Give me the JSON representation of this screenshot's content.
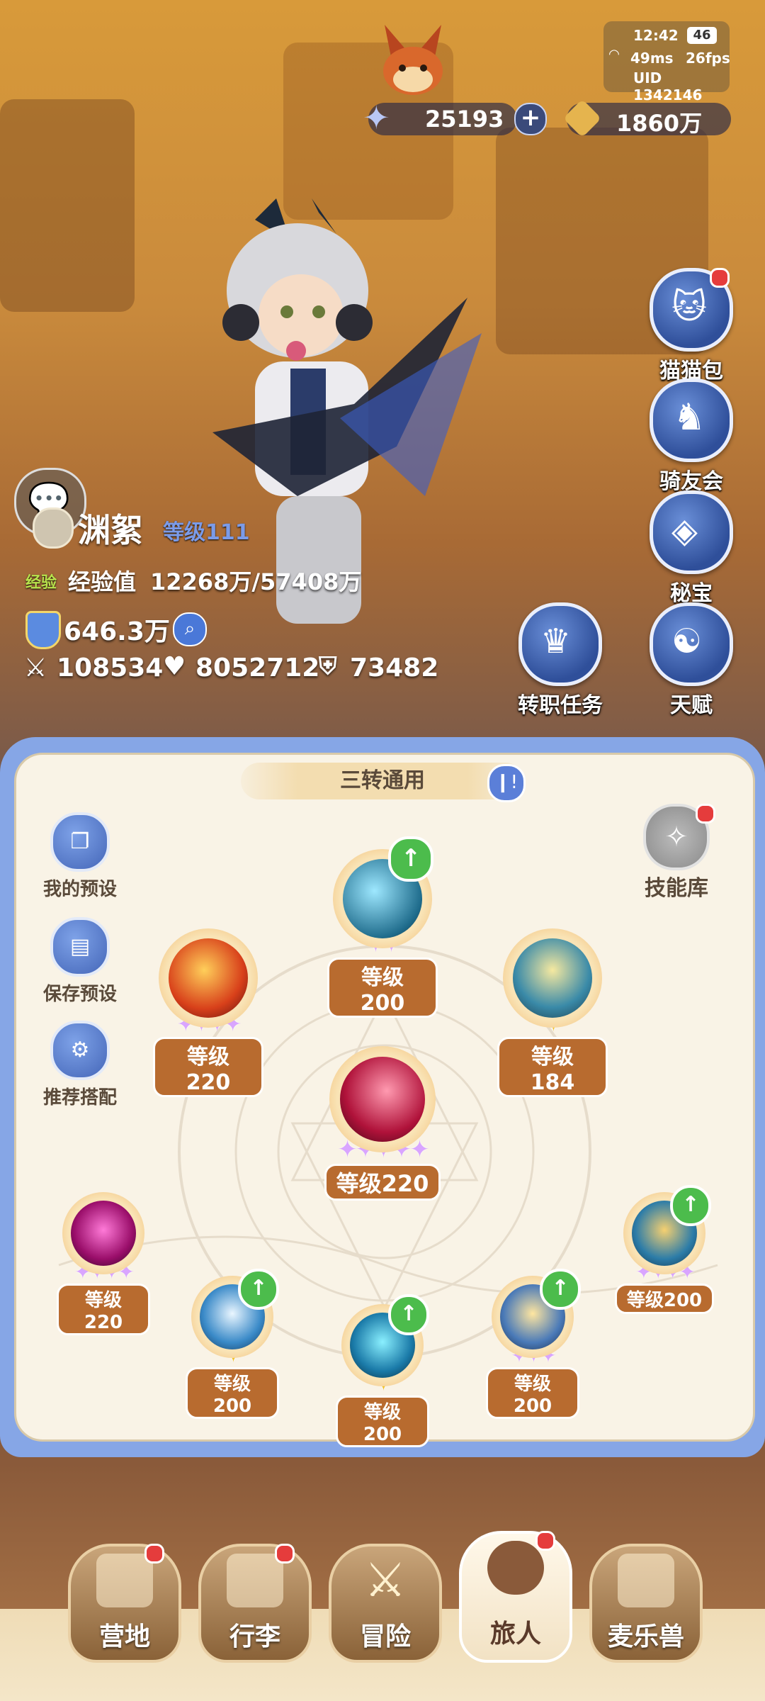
{
  "status": {
    "time": "12:42",
    "battery": "46",
    "ping": "49ms",
    "fps": "26fps",
    "uid": "UID 1342146"
  },
  "currency": {
    "stars": "25193",
    "plus": "+",
    "gold": "1860万"
  },
  "side_menu": [
    {
      "label": "猫猫包",
      "icon": "cat-bag-icon"
    },
    {
      "label": "骑友会",
      "icon": "horse-icon"
    },
    {
      "label": "秘宝",
      "icon": "treasure-icon"
    },
    {
      "label": "天赋",
      "icon": "brain-icon"
    }
  ],
  "job_quest": {
    "label": "转职任务"
  },
  "player": {
    "name": "渊絮",
    "level": "等级111",
    "exp_tag": "经验",
    "exp_label": "经验值",
    "exp_value": "12268万/57408万",
    "power": "646.3万",
    "attack": "108534",
    "hp": "8052712",
    "defense": "73482"
  },
  "panel": {
    "title": "三转通用",
    "skill_library": "技能库",
    "left_buttons": [
      "我的预设",
      "保存预设",
      "推荐搭配"
    ]
  },
  "skills": [
    {
      "level": "等级200",
      "stars": 2,
      "upgrade": true
    },
    {
      "level": "等级220",
      "stars": 4,
      "upgrade": false
    },
    {
      "level": "等级184",
      "stars": 1,
      "upgrade": false
    },
    {
      "level": "等级220",
      "stars": 5,
      "upgrade": false
    },
    {
      "level": "等级220",
      "stars": 4,
      "upgrade": false
    },
    {
      "level": "等级200",
      "stars": 4,
      "upgrade": true
    },
    {
      "level": "等级200",
      "stars": 1,
      "upgrade": true
    },
    {
      "level": "等级200",
      "stars": 1,
      "upgrade": true
    },
    {
      "level": "等级200",
      "stars": 3,
      "upgrade": true
    }
  ],
  "bottom_nav": [
    {
      "label": "营地",
      "badge": true
    },
    {
      "label": "行李",
      "badge": true
    },
    {
      "label": "冒险",
      "badge": false
    },
    {
      "label": "旅人",
      "badge": true
    },
    {
      "label": "麦乐兽",
      "badge": false
    }
  ],
  "colors": {
    "panel_border": "#86a6e6",
    "panel_bg": "#f9f3e6",
    "level_badge": "#b86b2f",
    "upgrade_green": "#4cbc4c",
    "badge_red": "#e53c3c"
  }
}
